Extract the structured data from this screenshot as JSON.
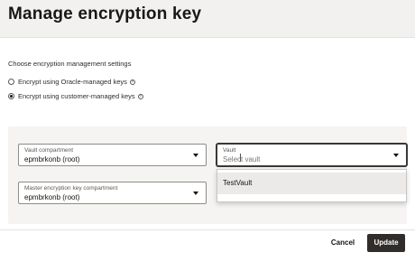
{
  "title": "Manage encryption key",
  "section": {
    "heading": "Choose encryption management settings"
  },
  "options": [
    {
      "label": "Encrypt using Oracle-managed keys",
      "selected": false,
      "info_icon": "info-icon"
    },
    {
      "label": "Encrypt using customer-managed keys",
      "selected": true,
      "info_icon": "info-icon"
    }
  ],
  "fields": {
    "vault_compartment": {
      "label": "Vault compartment",
      "value": "epmbrkonb (root)"
    },
    "vault": {
      "label": "Vault",
      "placeholder": "Select vault"
    },
    "master_key_compartment": {
      "label": "Master encryption key compartment",
      "value": "epmbrkonb (root)"
    }
  },
  "vault_dropdown": {
    "options": [
      "TestVault"
    ]
  },
  "buttons": {
    "cancel": "Cancel",
    "update": "Update"
  },
  "colors": {
    "primary_button": "#312d2a",
    "background": "#f2f1ef"
  }
}
